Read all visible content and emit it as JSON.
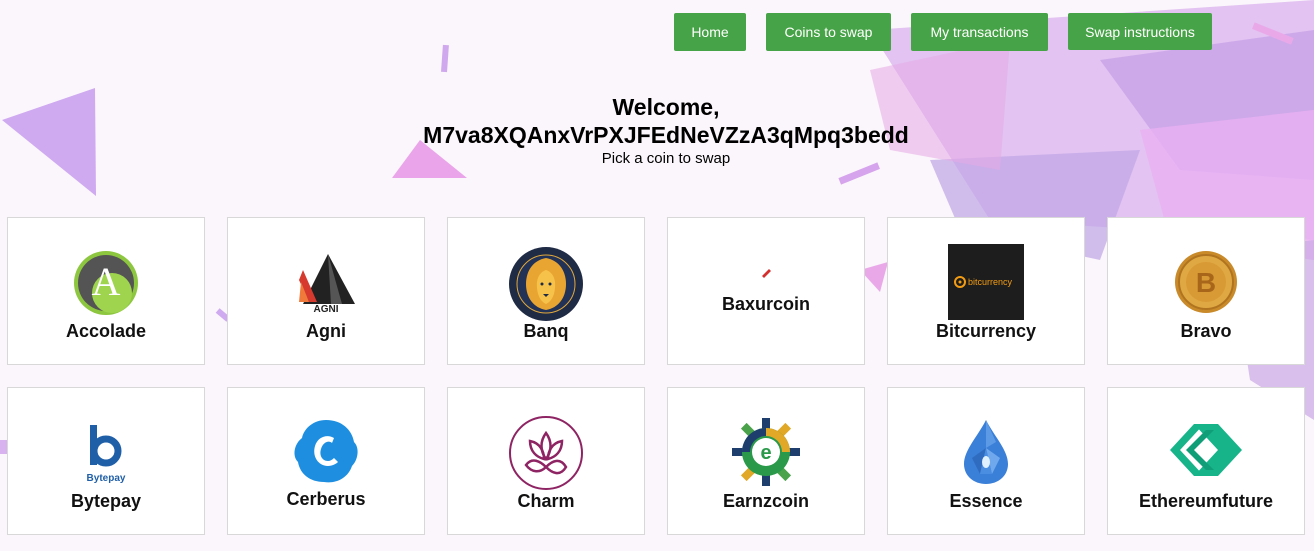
{
  "nav": {
    "home": "Home",
    "coins": "Coins to swap",
    "transactions": "My transactions",
    "instructions": "Swap instructions"
  },
  "welcome": {
    "title_line1": "Welcome,",
    "title_line2": "M7va8XQAnxVrPXJFEdNeVZzA3qMpq3bedd",
    "subtitle": "Pick a coin to swap"
  },
  "coins": [
    {
      "name": "Accolade",
      "icon": "accolade-logo-icon"
    },
    {
      "name": "Agni",
      "icon": "agni-logo-icon",
      "logo_text": "AGNI"
    },
    {
      "name": "Banq",
      "icon": "banq-lion-logo-icon"
    },
    {
      "name": "Baxurcoin",
      "icon": "baxurcoin-logo-icon"
    },
    {
      "name": "Bitcurrency",
      "icon": "bitcurrency-logo-icon",
      "logo_text": "bitcurrency"
    },
    {
      "name": "Bravo",
      "icon": "bravo-coin-logo-icon"
    },
    {
      "name": "Bytepay",
      "icon": "bytepay-logo-icon",
      "logo_text": "Bytepay"
    },
    {
      "name": "Cerberus",
      "icon": "cerberus-logo-icon"
    },
    {
      "name": "Charm",
      "icon": "charm-lotus-logo-icon"
    },
    {
      "name": "Earnzcoin",
      "icon": "earnzcoin-gear-logo-icon"
    },
    {
      "name": "Essence",
      "icon": "essence-drop-logo-icon"
    },
    {
      "name": "Ethereumfuture",
      "icon": "ethereumfuture-logo-icon"
    }
  ],
  "colors": {
    "button": "#47a347",
    "background": "#fbf6fb",
    "decor_purple": "#c9a7ec",
    "decor_pink": "#e7a6ea"
  }
}
